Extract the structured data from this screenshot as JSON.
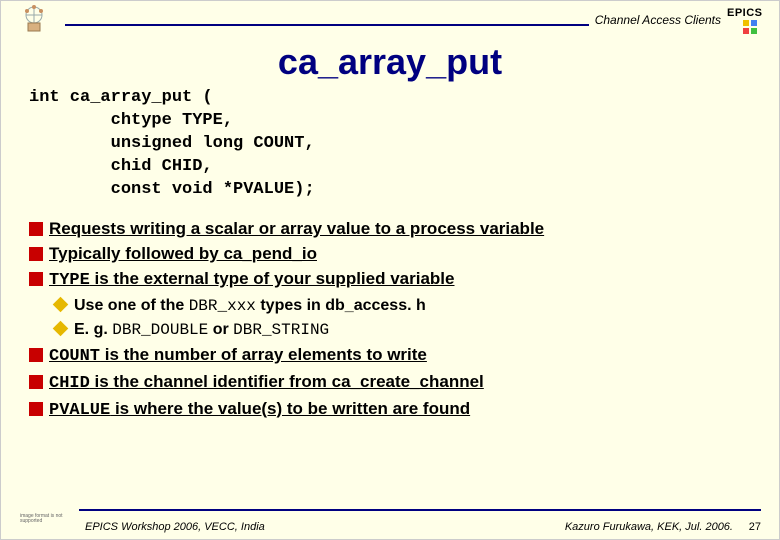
{
  "header": {
    "breadcrumb": "Channel Access Clients",
    "logo_text": "EPICS"
  },
  "title": "ca_array_put",
  "code": {
    "l1": "int ca_array_put (",
    "l2": "        chtype TYPE,",
    "l3": "        unsigned long COUNT,",
    "l4": "        chid CHID,",
    "l5": "        const void *PVALUE);"
  },
  "bullets": [
    {
      "level": 1,
      "lead": "Requests",
      "rest": " writing a scalar or array value to a process variable",
      "mono": false
    },
    {
      "level": 1,
      "lead": "Typically",
      "rest": " followed by ca_pend_io",
      "mono": false
    },
    {
      "level": 1,
      "lead": "TYPE",
      "rest": " is the external type of your supplied variable",
      "mono": true
    },
    {
      "level": 2,
      "lead": "Use",
      "rest_a": " one of the ",
      "mono_a": "DBR_xxx",
      "rest_b": " types in db_access. h"
    },
    {
      "level": 2,
      "lead": "E. g.",
      "rest_a": " ",
      "mono_a": "DBR_DOUBLE",
      "rest_b": " or ",
      "mono_b": "DBR_STRING"
    },
    {
      "level": 1,
      "lead": "COUNT",
      "rest": " is the number of array elements to write",
      "mono": true
    },
    {
      "level": 1,
      "lead": "CHID",
      "rest": " is the channel identifier from ca_create_channel",
      "mono": true
    },
    {
      "level": 1,
      "lead": "PVALUE",
      "rest": " is where the value(s) to be written are found",
      "mono": true
    }
  ],
  "footer": {
    "placeholder": "image format is not supported",
    "left": "EPICS Workshop 2006, VECC, India",
    "right": "Kazuro Furukawa, KEK, Jul. 2006.",
    "page": "27"
  }
}
